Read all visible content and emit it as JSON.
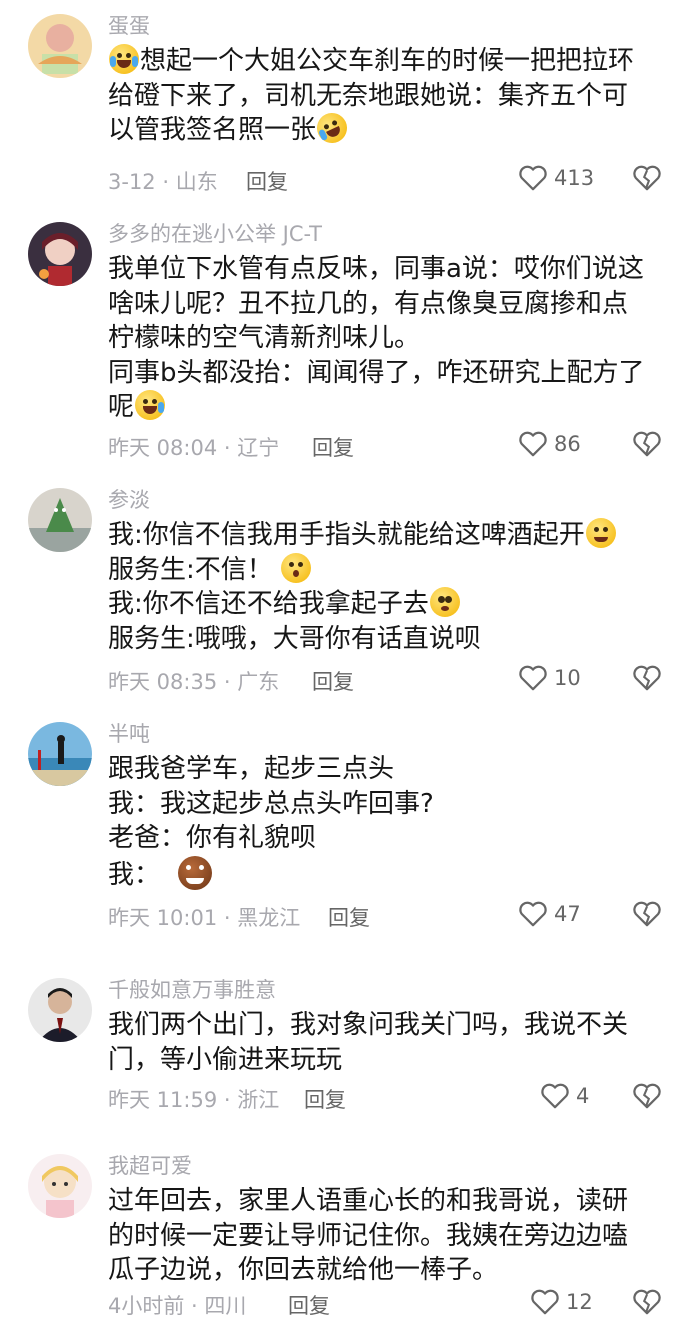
{
  "comments": [
    {
      "username": "蛋蛋",
      "lines": [
        [
          "想起一个大姐公交车刹车的时候一把把拉环"
        ],
        [
          "给磴下来了，司机无奈地跟她说：集齐五个可"
        ],
        [
          "以管我签名照一张"
        ]
      ],
      "time": "3-12",
      "location": "山东",
      "reply": "回复",
      "likes": "413",
      "icons": [
        "crying-face-emoji",
        "rolling-laughing-emoji"
      ]
    },
    {
      "username": "多多的在逃小公举 JC-T",
      "lines": [
        [
          "我单位下水管有点反味，同事a说：哎你们说这"
        ],
        [
          "啥味儿呢？丑不拉几的，有点像臭豆腐掺和点"
        ],
        [
          "柠檬味的空气清新剂味儿。"
        ],
        [
          "同事b头都没抬：闻闻得了，咋还研究上配方了"
        ],
        [
          "呢"
        ]
      ],
      "time": "昨天 08:04",
      "location": "辽宁",
      "reply": "回复",
      "likes": "86",
      "icons": [
        "laughing-sweat-emoji"
      ]
    },
    {
      "username": "参淡",
      "lines": [
        [
          "我:你信不信我用手指头就能给这啤酒起开"
        ],
        [
          "服务生:不信！"
        ],
        [
          "我:你不信还不给我拿起子去"
        ],
        [
          "服务生:哦哦，大哥你有话直说呗"
        ]
      ],
      "time": "昨天 08:35",
      "location": "广东",
      "reply": "回复",
      "likes": "10",
      "icons": [
        "smirk-emoji",
        "surprised-emoji",
        "dazed-emoji"
      ]
    },
    {
      "username": "半吨",
      "lines": [
        [
          "跟我爸学车，起步三点头"
        ],
        [
          "我：我这起步总点头咋回事?"
        ],
        [
          "老爸：你有礼貌呗"
        ],
        [
          "我："
        ]
      ],
      "time": "昨天 10:01",
      "location": "黑龙江",
      "reply": "回复",
      "likes": "47",
      "icons": [
        "cookie-face-emoji"
      ]
    },
    {
      "username": "千般如意万事胜意",
      "lines": [
        [
          "我们两个出门，我对象问我关门吗，我说不关"
        ],
        [
          "门，等小偷进来玩玩"
        ]
      ],
      "time": "昨天 11:59",
      "location": "浙江",
      "reply": "回复",
      "likes": "4",
      "icons": []
    },
    {
      "username": "我超可爱",
      "lines": [
        [
          "过年回去，家里人语重心长的和我哥说，读研"
        ],
        [
          "的时候一定要让导师记住你。我姨在旁边边嗑"
        ],
        [
          "瓜子边说，你回去就给他一棒子。"
        ]
      ],
      "time": "4小时前",
      "location": "四川",
      "reply": "回复",
      "likes": "12",
      "icons": []
    }
  ],
  "colors": {
    "text_primary": "#161616",
    "text_secondary": "#a8a8ae",
    "icon_gray": "#666666"
  },
  "icon_names": {
    "like": "heart-icon",
    "dislike": "broken-heart-icon"
  }
}
